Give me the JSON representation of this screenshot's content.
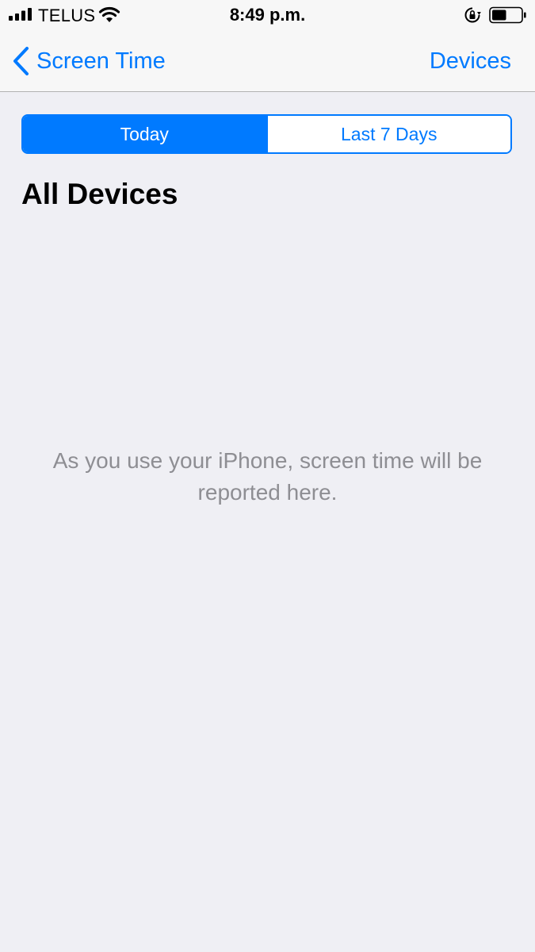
{
  "status_bar": {
    "carrier": "TELUS",
    "time": "8:49 p.m.",
    "signal_icon": "signal-bars-icon",
    "wifi_icon": "wifi-icon",
    "lock_icon": "rotation-lock-icon",
    "battery_icon": "battery-icon",
    "battery_level": 0.5
  },
  "nav": {
    "back_label": "Screen Time",
    "back_icon": "chevron-left-icon",
    "right_label": "Devices"
  },
  "segments": {
    "today": "Today",
    "last7": "Last 7 Days",
    "selected": "today"
  },
  "main": {
    "title": "All Devices",
    "empty_message": "As you use your iPhone, screen time will be reported here."
  },
  "colors": {
    "accent": "#007aff",
    "background": "#efeff4",
    "secondary_text": "#8e8e93"
  }
}
